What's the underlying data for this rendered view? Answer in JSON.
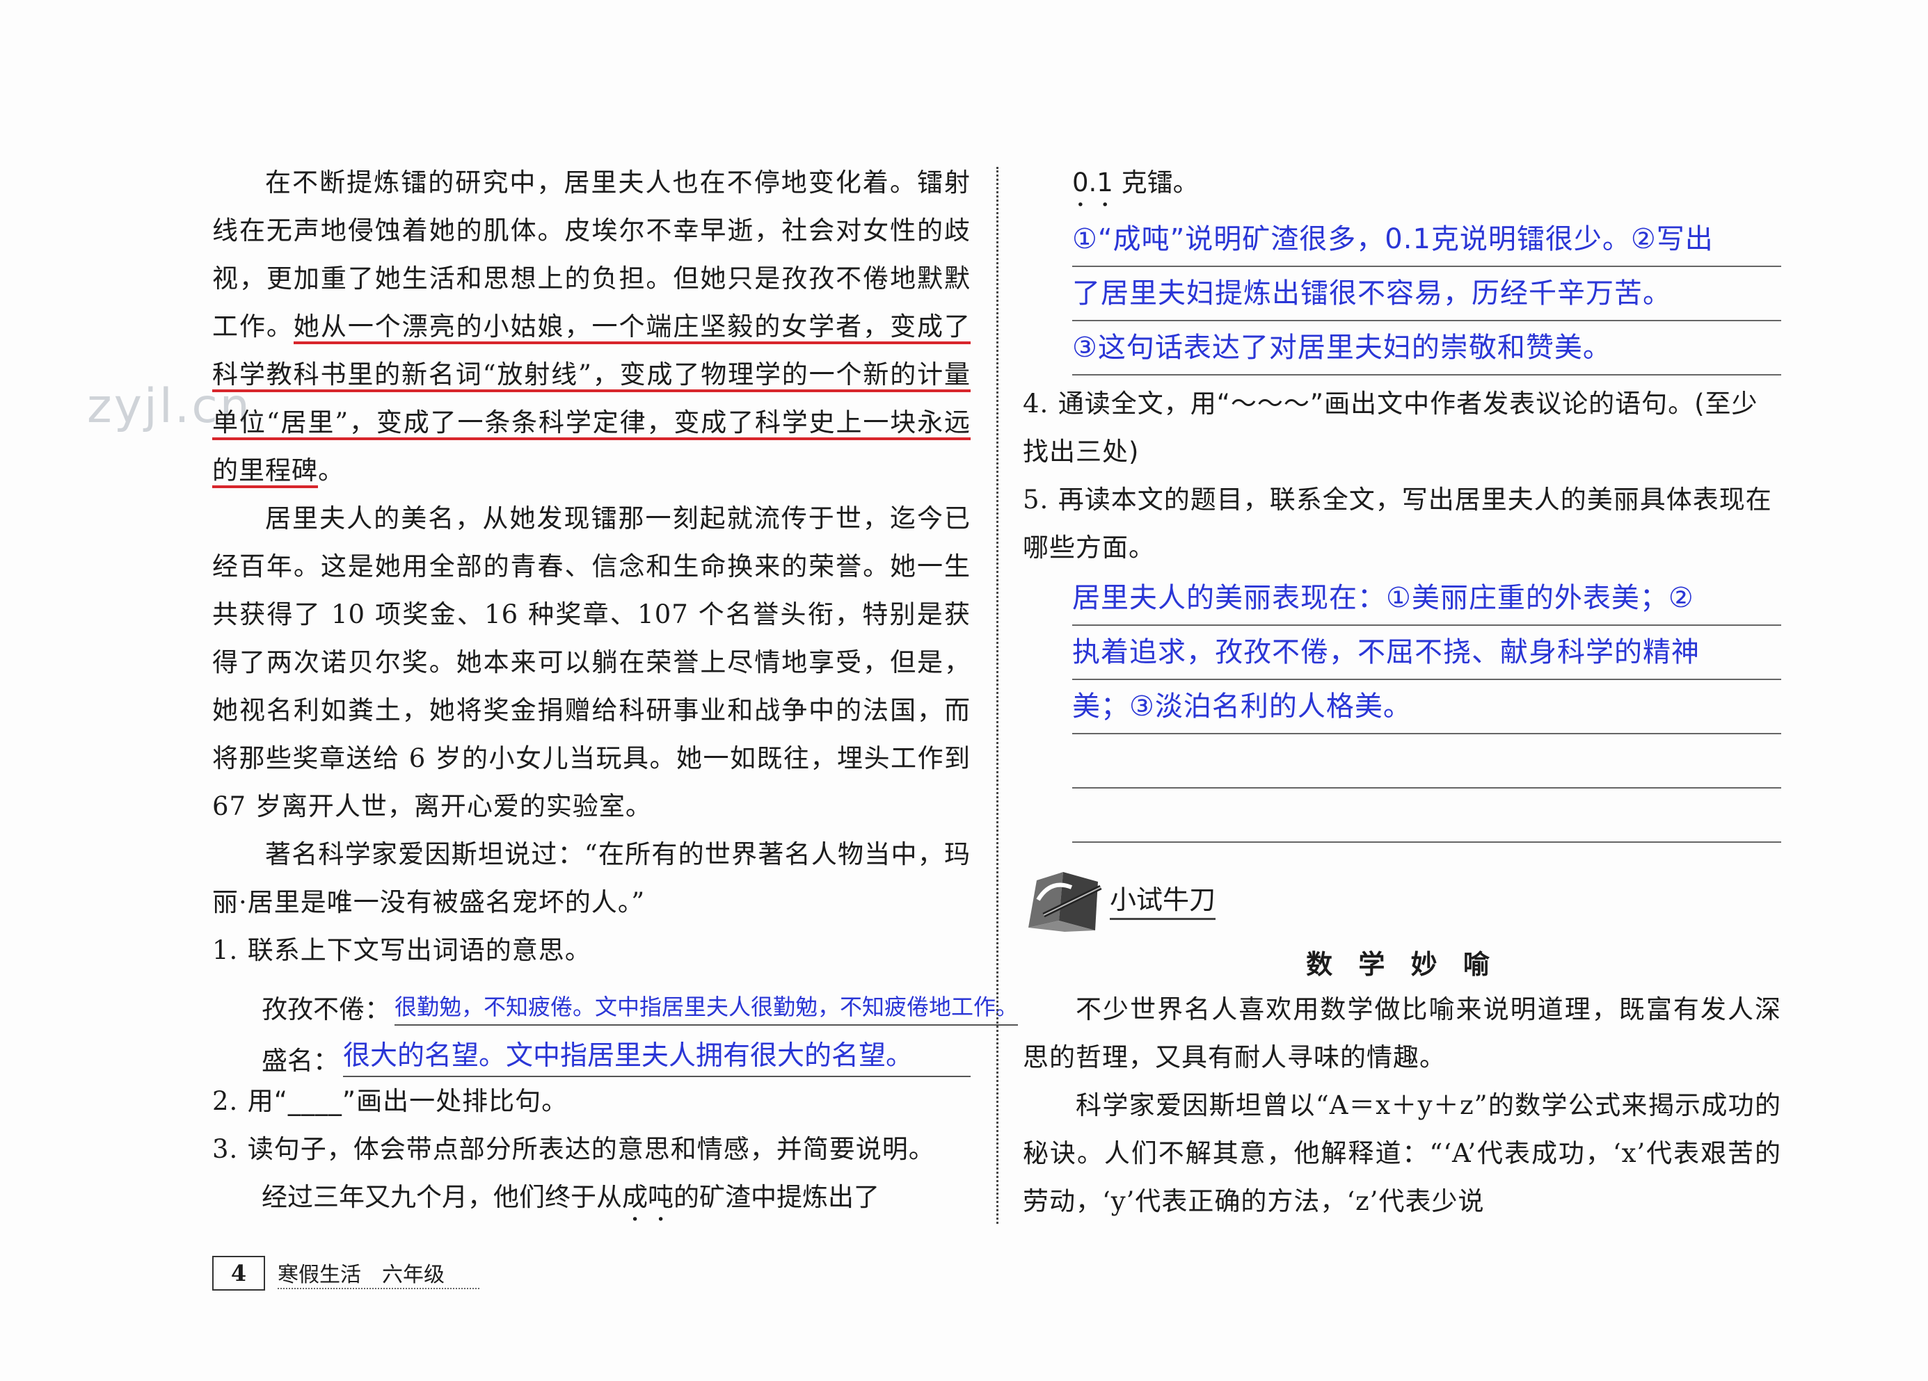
{
  "watermark": "zyjl.cn",
  "left": {
    "p1_a": "在不断提炼镭的研究中，居里夫人也在不停地变化着。镭射线在无声地侵蚀着她的肌体。皮埃尔不幸早逝，社会对女性的歧视，更加重了她生活和思想上的负担。但她只是孜孜不倦地默默工作。",
    "p1_b": "她从一个漂亮的小姑娘，一个端庄坚毅的女学者，变成了科学教科书里的新名词“放射线”，变成了物理学的一个新的计量单位“居里”，变成了一条条科学定律，变成了科学史上一块永远的里程碑",
    "p1_c": "。",
    "p2_a": "居里夫人的美名，从她发现镭那一刻起就流传于世，迄今已经百年。这是她用全部的青春、信念和生命换来的荣誉。她一生共获得了 10 项奖金、16 种奖章、107 个名誉头衔，特别是获得了两次诺贝尔奖。她本来可以躺在荣誉上尽情地享受，但是，她视名利如粪土，她将奖金捐赠给科研事业和战争中的法国，而将那些奖章送给 6 岁的小女儿当玩具。她一如既往，埋头工作到 67 岁离开人世，离开心爱的实验室。",
    "p3": "著名科学家爱因斯坦说过：“在所有的世界著名人物当中，玛丽·居里是唯一没有被盛名宠坏的人。”",
    "q1_num": "1.",
    "q1": "联系上下文写出词语的意思。",
    "q1a_label": "孜孜不倦：",
    "q1a_answer": "很勤勉，不知疲倦。文中指居里夫人很勤勉，不知疲倦地工作。",
    "q1b_label": "盛名：",
    "q1b_answer": "很大的名望。文中指居里夫人拥有很大的名望。",
    "q2_num": "2.",
    "q2": "用“____”画出一处排比句。",
    "q3_num": "3.",
    "q3": "读句子，体会带点部分所表达的意思和情感，并简要说明。",
    "q3_sentence_a": "经过三年又九个月，他们终于从",
    "q3_sentence_dots": "成吨",
    "q3_sentence_b": "的矿渣中提炼出了"
  },
  "right": {
    "cont_dots": "0.1",
    "cont_rest": " 克镭。",
    "ans3": [
      "①“成吨”说明矿渣很多，0.1克说明镭很少。②写出",
      "了居里夫妇提炼出镭很不容易，历经千辛万苦。",
      "③这句话表达了对居里夫妇的崇敬和赞美。"
    ],
    "q4_num": "4.",
    "q4": "通读全文，用“～～～”画出文中作者发表议论的语句。(至少找出三处)",
    "q5_num": "5.",
    "q5": "再读本文的题目，联系全文，写出居里夫人的美丽具体表现在哪些方面。",
    "ans5": [
      "居里夫人的美丽表现在：①美丽庄重的外表美；②",
      "执着追求，孜孜不倦，不屈不挠、献身科学的精神",
      "美；③淡泊名利的人格美。"
    ],
    "section_title": "小试牛刀",
    "story_title": "数 学 妙 喻",
    "story_p1": "不少世界名人喜欢用数学做比喻来说明道理，既富有发人深思的哲理，又具有耐人寻味的情趣。",
    "story_p2": "科学家爱因斯坦曾以“A＝x＋y＋z”的数学公式来揭示成功的秘诀。人们不解其意，他解释道：“‘A’代表成功，‘x’代表艰苦的劳动，‘y’代表正确的方法，‘z’代表少说"
  },
  "footer": {
    "page_number": "4",
    "book": "寒假生活　六年级"
  },
  "colors": {
    "answer": "#2a36d6",
    "red_underline": "#d8262c",
    "wavy_underline": "#2740c8"
  },
  "icons": {
    "section": "pen-on-book-icon"
  }
}
